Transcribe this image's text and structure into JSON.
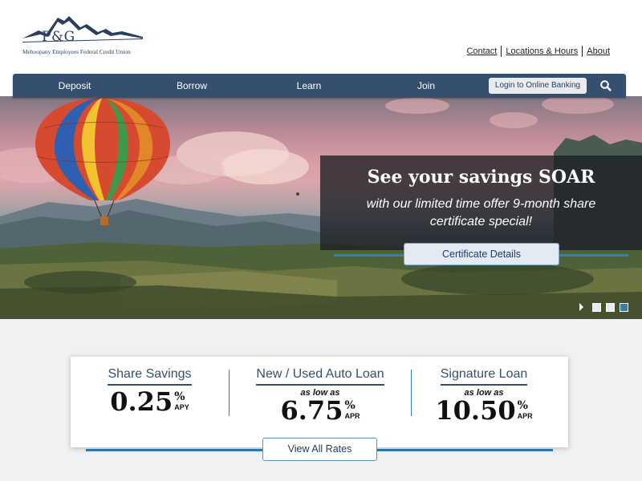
{
  "logo": {
    "letters": "P&G",
    "subtitle": "Mehoopany Employees Federal Credit Union"
  },
  "utility_links": [
    "Contact",
    "Locations & Hours",
    "About"
  ],
  "nav": {
    "items": [
      "Deposit",
      "Borrow",
      "Learn",
      "Join"
    ],
    "login_label": "Login to Online Banking",
    "search_icon": "search-icon"
  },
  "hero": {
    "title": "See your savings SOAR",
    "text": "with our limited time offer 9-month share certificate special!",
    "button_label": "Certificate Details",
    "slides": {
      "count": 3,
      "active_index": 2
    },
    "colors": {
      "overlay": "#1c1e22",
      "accent_line": "#2f7fb8"
    }
  },
  "rates": {
    "items": [
      {
        "title": "Share Savings",
        "subtitle": "",
        "value": "0.25",
        "percent": "%",
        "unit": "APY"
      },
      {
        "title": "New / Used Auto Loan",
        "subtitle": "as low as",
        "value": "6.75",
        "percent": "%",
        "unit": "APR"
      },
      {
        "title": "Signature Loan",
        "subtitle": "as low as",
        "value": "10.50",
        "percent": "%",
        "unit": "APR"
      }
    ],
    "button_label": "View All Rates"
  },
  "colors": {
    "brand_navy": "#35506e",
    "accent_blue": "#2f7fb8",
    "section_bg": "#f0f1f2"
  }
}
